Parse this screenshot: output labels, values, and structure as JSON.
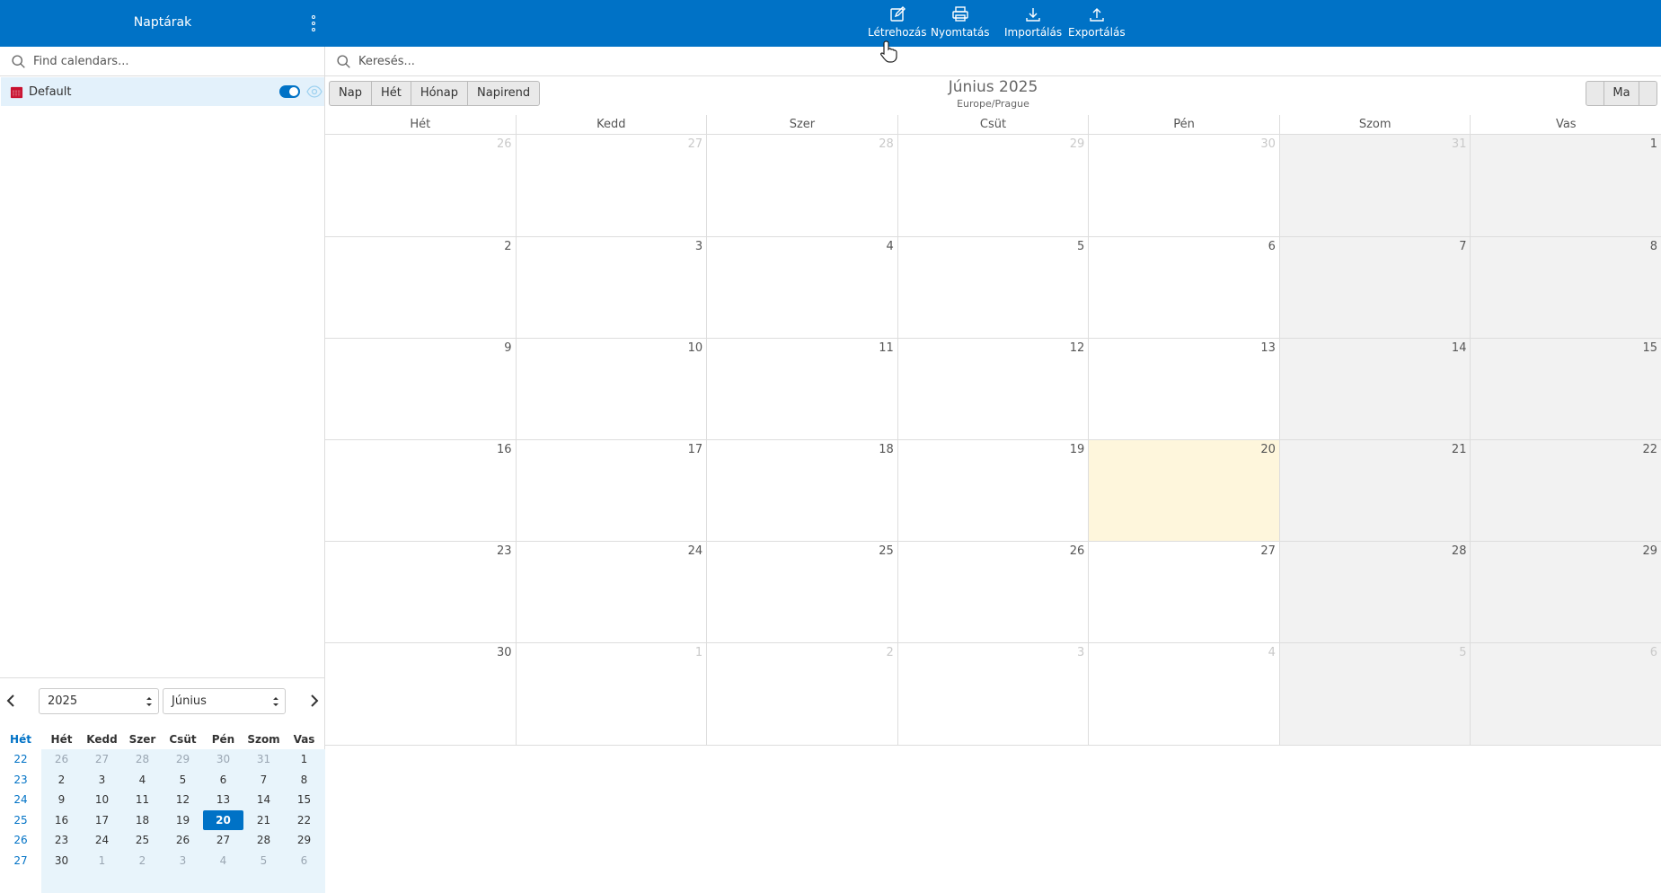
{
  "topbar": {
    "title": "Naptárak",
    "tools": [
      {
        "label": "Létrehozás",
        "icon": "edit-icon"
      },
      {
        "label": "Nyomtatás",
        "icon": "print-icon"
      },
      {
        "label": "Importálás",
        "icon": "download-icon"
      },
      {
        "label": "Exportálás",
        "icon": "upload-icon"
      }
    ]
  },
  "sidebar": {
    "search_placeholder": "Find calendars...",
    "calendars": [
      {
        "name": "Default",
        "enabled": true
      }
    ],
    "mini": {
      "year": "2025",
      "month": "Június",
      "headers": [
        "Hét",
        "Hét",
        "Kedd",
        "Szer",
        "Csüt",
        "Pén",
        "Szom",
        "Vas"
      ],
      "weeks": [
        {
          "wk": "22",
          "days": [
            "26",
            "27",
            "28",
            "29",
            "30",
            "31",
            "1"
          ]
        },
        {
          "wk": "23",
          "days": [
            "2",
            "3",
            "4",
            "5",
            "6",
            "7",
            "8"
          ]
        },
        {
          "wk": "24",
          "days": [
            "9",
            "10",
            "11",
            "12",
            "13",
            "14",
            "15"
          ]
        },
        {
          "wk": "25",
          "days": [
            "16",
            "17",
            "18",
            "19",
            "20",
            "21",
            "22"
          ]
        },
        {
          "wk": "26",
          "days": [
            "23",
            "24",
            "25",
            "26",
            "27",
            "28",
            "29"
          ]
        },
        {
          "wk": "27",
          "days": [
            "30",
            "1",
            "2",
            "3",
            "4",
            "5",
            "6"
          ]
        }
      ]
    }
  },
  "main": {
    "search_placeholder": "Keresés...",
    "views": [
      "Nap",
      "Hét",
      "Hónap",
      "Napirend"
    ],
    "title": "Június 2025",
    "timezone": "Europe/Prague",
    "today_label": "Ma",
    "dow": [
      "Hét",
      "Kedd",
      "Szer",
      "Csüt",
      "Pén",
      "Szom",
      "Vas"
    ],
    "weeks": [
      [
        "26",
        "27",
        "28",
        "29",
        "30",
        "31",
        "1"
      ],
      [
        "2",
        "3",
        "4",
        "5",
        "6",
        "7",
        "8"
      ],
      [
        "9",
        "10",
        "11",
        "12",
        "13",
        "14",
        "15"
      ],
      [
        "16",
        "17",
        "18",
        "19",
        "20",
        "21",
        "22"
      ],
      [
        "23",
        "24",
        "25",
        "26",
        "27",
        "28",
        "29"
      ],
      [
        "30",
        "1",
        "2",
        "3",
        "4",
        "5",
        "6"
      ]
    ],
    "today": "20"
  },
  "colors": {
    "accent": "#0072c6",
    "today_bg": "#fef6dc",
    "weekend_bg": "#f2f2f2"
  }
}
